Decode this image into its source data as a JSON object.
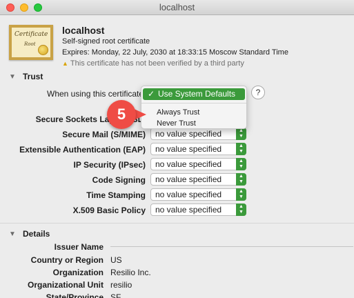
{
  "window": {
    "title": "localhost"
  },
  "header": {
    "icon_title": "Certificate",
    "icon_subtitle": "Root",
    "name": "localhost",
    "subtitle": "Self-signed root certificate",
    "expires": "Expires: Monday, 22 July, 2030 at 18:33:15 Moscow Standard Time",
    "warning": "This certificate has not been verified by a third party"
  },
  "trust": {
    "section_title": "Trust",
    "when_using_label": "When using this certificate:",
    "help_label": "?",
    "menu": {
      "selected": "Use System Defaults",
      "items": [
        "Always Trust",
        "Never Trust"
      ]
    },
    "rows": [
      {
        "label": "Secure Sockets Layer (SSL)",
        "value": ""
      },
      {
        "label": "Secure Mail (S/MIME)",
        "value": "no value specified"
      },
      {
        "label": "Extensible Authentication (EAP)",
        "value": "no value specified"
      },
      {
        "label": "IP Security (IPsec)",
        "value": "no value specified"
      },
      {
        "label": "Code Signing",
        "value": "no value specified"
      },
      {
        "label": "Time Stamping",
        "value": "no value specified"
      },
      {
        "label": "X.509 Basic Policy",
        "value": "no value specified"
      }
    ]
  },
  "step_badge": "5",
  "details": {
    "section_title": "Details",
    "rows": [
      {
        "label": "Issuer Name",
        "value": ""
      },
      {
        "label": "Country or Region",
        "value": "US"
      },
      {
        "label": "Organization",
        "value": "Resilio Inc."
      },
      {
        "label": "Organizational Unit",
        "value": "resilio"
      },
      {
        "label": "State/Province",
        "value": "SF"
      }
    ]
  },
  "colors": {
    "accent_green": "#3b9a3b",
    "badge_red": "#ef4c45"
  }
}
